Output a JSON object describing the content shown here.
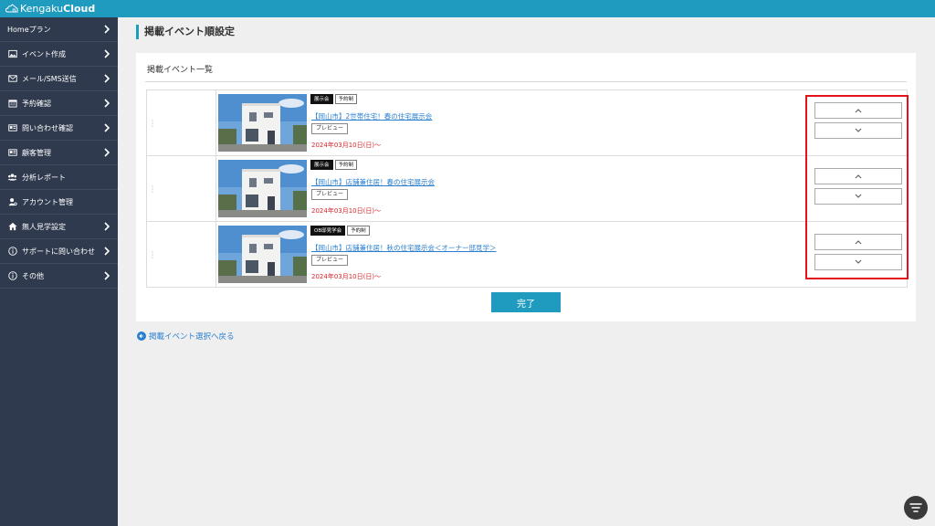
{
  "header": {
    "logo_light": "Kengaku",
    "logo_bold": "Cloud"
  },
  "sidebar": {
    "items": [
      {
        "label": "Homeプラン",
        "icon": "none",
        "has_chevron": true
      },
      {
        "label": "イベント作成",
        "icon": "image-icon",
        "has_chevron": true
      },
      {
        "label": "メール/SMS送信",
        "icon": "mail-icon",
        "has_chevron": true
      },
      {
        "label": "予約確認",
        "icon": "calendar-icon",
        "has_chevron": true
      },
      {
        "label": "問い合わせ確認",
        "icon": "id-card-icon",
        "has_chevron": true
      },
      {
        "label": "顧客管理",
        "icon": "id-card-icon",
        "has_chevron": true
      },
      {
        "label": "分析レポート",
        "icon": "users-icon",
        "has_chevron": false
      },
      {
        "label": "アカウント管理",
        "icon": "user-gear-icon",
        "has_chevron": false
      },
      {
        "label": "無人見学設定",
        "icon": "home-icon",
        "has_chevron": true
      },
      {
        "label": "サポートに問い合わせ",
        "icon": "info-icon",
        "has_chevron": true
      },
      {
        "label": "その他",
        "icon": "info-icon",
        "has_chevron": true
      }
    ]
  },
  "page": {
    "title": "掲載イベント順設定"
  },
  "card": {
    "heading": "掲載イベント一覧"
  },
  "events": [
    {
      "tags": [
        "展示会",
        "予約制"
      ],
      "title": "【岡山市】2世帯住宅！春の住宅展示会",
      "preview_label": "プレビュー",
      "date": "2024年03月10日(日)〜"
    },
    {
      "tags": [
        "展示会",
        "予約制"
      ],
      "title": "【岡山市】店舗兼住居！春の住宅展示会",
      "preview_label": "プレビュー",
      "date": "2024年03月10日(日)〜"
    },
    {
      "tags": [
        "OB邸見学会",
        "予約制"
      ],
      "title": "【岡山市】店舗兼住居！秋の住宅展示会＜オーナー邸見学＞",
      "preview_label": "プレビュー",
      "date": "2024年03月10日(日)〜"
    }
  ],
  "actions": {
    "done_label": "完了",
    "back_label": "掲載イベント選択へ戻る"
  },
  "colors": {
    "accent": "#1e9bbf",
    "sidebar": "#2f3a4e",
    "highlight": "#e5121c",
    "date": "#d9262c",
    "link": "#2a7fd0"
  }
}
